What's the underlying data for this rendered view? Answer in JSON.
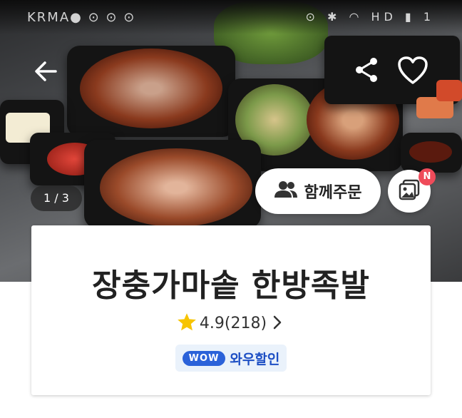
{
  "status_bar": {
    "left_text": "KRMA● ⊙ ⊙ ⊙",
    "right_text": "⊙ ✱ ◠ HD ▮ 1"
  },
  "hero": {
    "pager": "1 / 3"
  },
  "actions": {
    "group_order_label": "함께주문",
    "photo_badge": "N"
  },
  "store": {
    "name": "장충가마솥 한방족발",
    "rating": "4.9(218)",
    "promo_tag": "WOW",
    "promo_label": "와우할인"
  },
  "colors": {
    "accent": "#2b62d9",
    "badge": "#ef4b5a",
    "star": "#f7c400"
  }
}
